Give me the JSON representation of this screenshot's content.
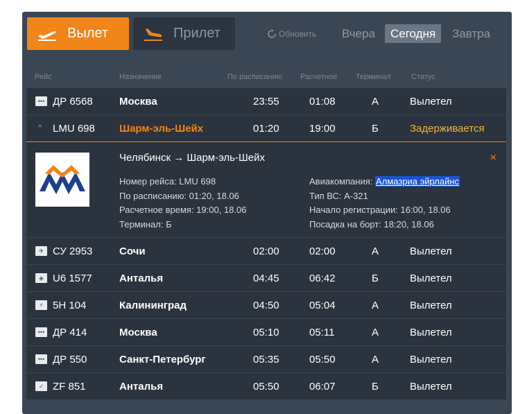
{
  "tabs": {
    "departure": "Вылет",
    "arrival": "Прилет"
  },
  "refresh_label": "Обновить",
  "days": {
    "yesterday": "Вчера",
    "today": "Сегодня",
    "tomorrow": "Завтра"
  },
  "columns": {
    "flight": "Рейс",
    "destination": "Назначение",
    "scheduled": "По расписанию",
    "estimated": "Расчетное",
    "terminal": "Терминал",
    "status": "Статус"
  },
  "rows": [
    {
      "flight": "ДР 6568",
      "destination": "Москва",
      "scheduled": "23:55",
      "estimated": "01:08",
      "terminal": "А",
      "status": "Вылетел",
      "logo_icon": "dots-logo-icon"
    },
    {
      "flight": "LMU 698",
      "destination": "Шарм-эль-Шейх",
      "scheduled": "01:20",
      "estimated": "19:00",
      "terminal": "Б",
      "status": "Задерживается",
      "logo_icon": "expand-caret-icon"
    },
    {
      "flight": "СУ 2953",
      "destination": "Сочи",
      "scheduled": "02:00",
      "estimated": "02:00",
      "terminal": "А",
      "status": "Вылетел",
      "logo_icon": "aeroflot-logo-icon"
    },
    {
      "flight": "U6 1577",
      "destination": "Анталья",
      "scheduled": "04:45",
      "estimated": "06:42",
      "terminal": "Б",
      "status": "Вылетел",
      "logo_icon": "ural-logo-icon"
    },
    {
      "flight": "5Н 104",
      "destination": "Калининград",
      "scheduled": "04:50",
      "estimated": "05:04",
      "terminal": "А",
      "status": "Вылетел",
      "logo_icon": "s7-logo-icon"
    },
    {
      "flight": "ДР 414",
      "destination": "Москва",
      "scheduled": "05:10",
      "estimated": "05:11",
      "terminal": "А",
      "status": "Вылетел",
      "logo_icon": "dots-logo-icon"
    },
    {
      "flight": "ДР 550",
      "destination": "Санкт-Петербург",
      "scheduled": "05:35",
      "estimated": "05:50",
      "terminal": "А",
      "status": "Вылетел",
      "logo_icon": "dots-logo-icon"
    },
    {
      "flight": "ZF 851",
      "destination": "Анталья",
      "scheduled": "05:50",
      "estimated": "06:07",
      "terminal": "Б",
      "status": "Вылетел",
      "logo_icon": "azur-logo-icon"
    }
  ],
  "detail": {
    "route": "Челябинск → Шарм-эль-Шейх",
    "flight_number": "Номер рейса: LMU 698",
    "scheduled": "По расписанию: 01:20, 18.06",
    "estimated": "Расчетное время: 19:00, 18.06",
    "terminal": "Терминал: Б",
    "airline_label": "Авиакомпания: ",
    "airline_name": "Алмазриа эйрлайнс",
    "aircraft": "Тип ВС: А-321",
    "checkin": "Начало регистрации: 16:00, 18.06",
    "boarding": "Посадка на борт: 18:20, 18.06",
    "close": "×"
  },
  "colors": {
    "accent": "#f0851a",
    "board_bg": "#3b4654",
    "row_bg": "#2b333e",
    "delayed": "#f0b43a",
    "link_highlight": "#1a55d6"
  }
}
